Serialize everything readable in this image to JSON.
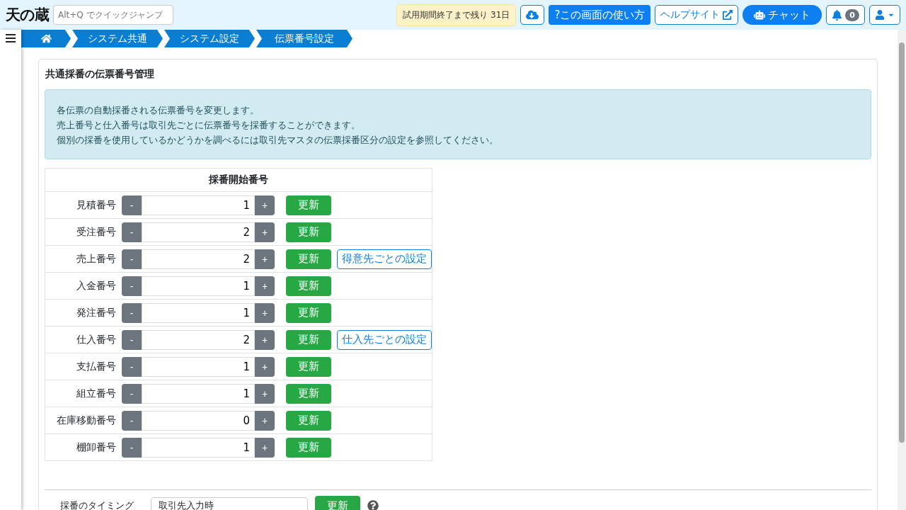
{
  "header": {
    "logo": "天の蔵",
    "search": {
      "placeholder": "Alt+Q でクイックジャンプ"
    },
    "trial_badge": "試用期間終了まで残り 31日",
    "help_button": "?この画面の使い方",
    "help_site_link": "ヘルプサイト",
    "chat_button": "チャット",
    "notification_count": "0"
  },
  "breadcrumbs": [
    {
      "kind": "home"
    },
    {
      "kind": "text",
      "label": "システム共通"
    },
    {
      "kind": "text",
      "label": "システム設定"
    },
    {
      "kind": "text",
      "label": "伝票番号設定"
    }
  ],
  "card": {
    "title": "共通採番の伝票番号管理",
    "info_lines": [
      "各伝票の自動採番される伝票番号を変更します。",
      "売上番号と仕入番号は取引先ごとに伝票番号を採番することができます。",
      "個別の採番を使用しているかどうかを調べるには取引先マスタの伝票採番区分の設定を参照してください。"
    ],
    "table": {
      "header": "採番開始番号",
      "rows": [
        {
          "label": "見積番号",
          "decrement": "-",
          "value": "1",
          "increment": "+",
          "update": "更新"
        },
        {
          "label": "受注番号",
          "decrement": "-",
          "value": "2",
          "increment": "+",
          "update": "更新"
        },
        {
          "label": "売上番号",
          "decrement": "-",
          "value": "2",
          "increment": "+",
          "update": "更新",
          "link": "得意先ごとの設定"
        },
        {
          "label": "入金番号",
          "decrement": "-",
          "value": "1",
          "increment": "+",
          "update": "更新"
        },
        {
          "label": "発注番号",
          "decrement": "-",
          "value": "1",
          "increment": "+",
          "update": "更新"
        },
        {
          "label": "仕入番号",
          "decrement": "-",
          "value": "2",
          "increment": "+",
          "update": "更新",
          "link": "仕入先ごとの設定"
        },
        {
          "label": "支払番号",
          "decrement": "-",
          "value": "1",
          "increment": "+",
          "update": "更新"
        },
        {
          "label": "組立番号",
          "decrement": "-",
          "value": "1",
          "increment": "+",
          "update": "更新"
        },
        {
          "label": "在庫移動番号",
          "decrement": "-",
          "value": "0",
          "increment": "+",
          "update": "更新"
        },
        {
          "label": "棚卸番号",
          "decrement": "-",
          "value": "1",
          "increment": "+",
          "update": "更新"
        }
      ]
    },
    "timing": {
      "label": "採番のタイミング",
      "value": "取引先入力時",
      "update": "更新"
    }
  }
}
